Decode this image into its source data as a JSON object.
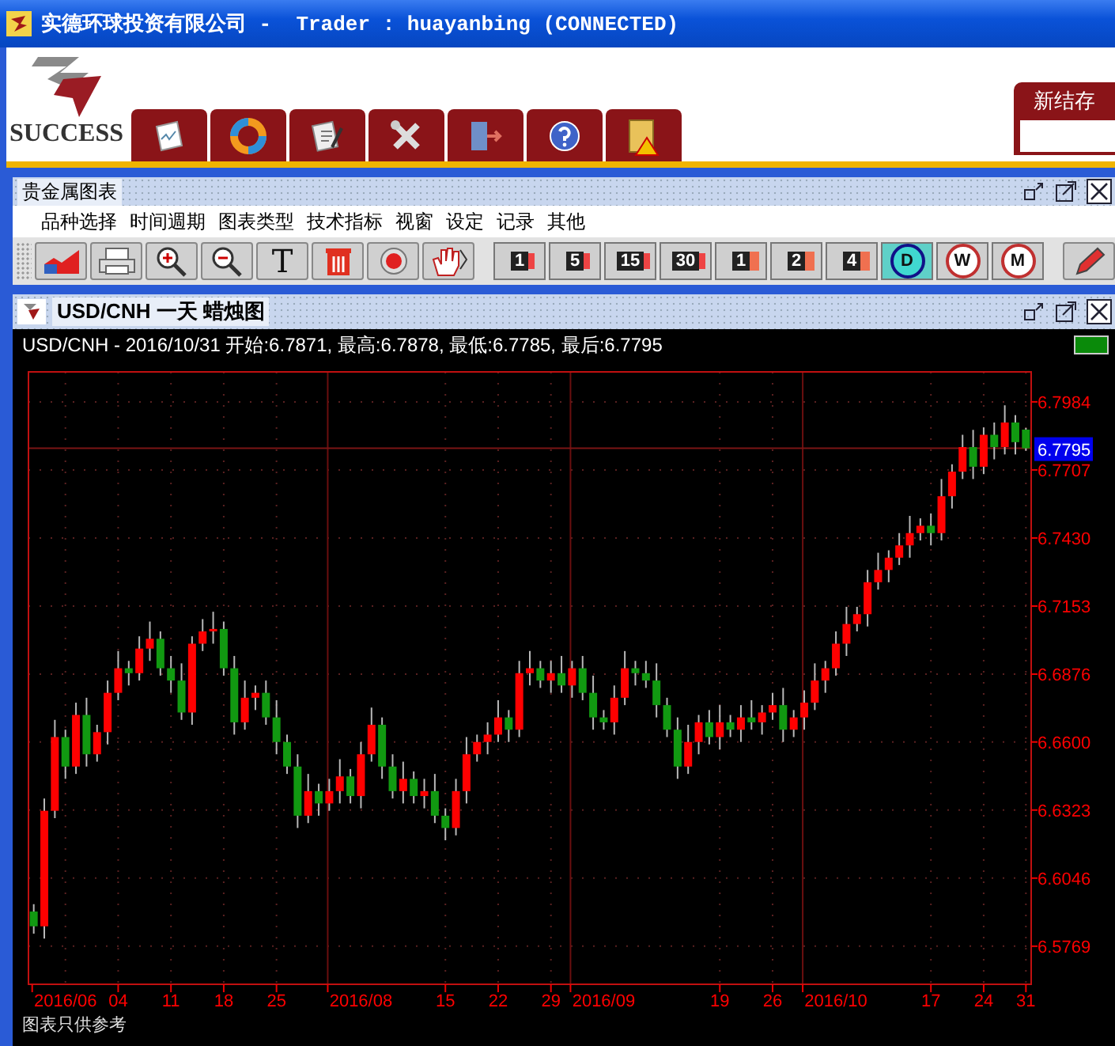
{
  "window": {
    "title": "实德环球投资有限公司 -  Trader : huayanbing (CONNECTED)"
  },
  "brand": {
    "name": "SUCCESS"
  },
  "balance_panel": {
    "label": "新结存"
  },
  "panel": {
    "title": "贵金属图表",
    "menu": [
      "品种选择",
      "时间週期",
      "图表类型",
      "技术指标",
      "视窗",
      "设定",
      "记录",
      "其他"
    ]
  },
  "toolbar": {
    "text_tool": "T",
    "periods": [
      {
        "label": "1",
        "kind": "minute",
        "selected": false
      },
      {
        "label": "5",
        "kind": "minute",
        "selected": false
      },
      {
        "label": "15",
        "kind": "minute",
        "selected": false
      },
      {
        "label": "30",
        "kind": "minute",
        "selected": false
      },
      {
        "label": "1",
        "kind": "hour",
        "selected": false
      },
      {
        "label": "2",
        "kind": "hour",
        "selected": false
      },
      {
        "label": "4",
        "kind": "hour",
        "selected": false
      },
      {
        "label": "D",
        "kind": "day",
        "selected": true
      },
      {
        "label": "W",
        "kind": "day",
        "selected": false
      },
      {
        "label": "M",
        "kind": "day",
        "selected": false
      }
    ]
  },
  "chart_window": {
    "title": "USD/CNH 一天 蜡烛图",
    "info": "USD/CNH - 2016/10/31 开始:6.7871, 最高:6.7878, 最低:6.7785, 最后:6.7795",
    "chart_data": {
      "type": "candlestick",
      "categories": [
        null,
        null,
        null,
        "2016/06",
        null,
        null,
        null,
        null,
        "04",
        null,
        null,
        null,
        null,
        "11",
        null,
        null,
        null,
        null,
        "18",
        null,
        null,
        null,
        null,
        "25",
        null,
        null,
        null,
        null,
        null,
        null,
        null,
        "2016/08",
        null,
        null,
        null,
        null,
        null,
        null,
        null,
        "15",
        null,
        null,
        null,
        null,
        "22",
        null,
        null,
        null,
        null,
        "29",
        null,
        null,
        null,
        null,
        "2016/09",
        null,
        null,
        null,
        null,
        null,
        null,
        null,
        null,
        null,
        null,
        "19",
        null,
        null,
        null,
        null,
        "26",
        null,
        null,
        null,
        null,
        null,
        "2016/10",
        null,
        null,
        null,
        null,
        null,
        null,
        null,
        null,
        "17",
        null,
        null,
        null,
        null,
        "24",
        null,
        null,
        null,
        "31"
      ],
      "ohlc": [
        [
          6.591,
          6.594,
          6.582,
          6.585
        ],
        [
          6.585,
          6.637,
          6.58,
          6.632
        ],
        [
          6.632,
          6.669,
          6.629,
          6.662
        ],
        [
          6.662,
          6.665,
          6.645,
          6.65
        ],
        [
          6.65,
          6.676,
          6.647,
          6.671
        ],
        [
          6.671,
          6.678,
          6.65,
          6.655
        ],
        [
          6.655,
          6.667,
          6.652,
          6.664
        ],
        [
          6.664,
          6.685,
          6.659,
          6.68
        ],
        [
          6.68,
          6.697,
          6.677,
          6.69
        ],
        [
          6.69,
          6.693,
          6.683,
          6.688
        ],
        [
          6.688,
          6.703,
          6.685,
          6.698
        ],
        [
          6.698,
          6.709,
          6.693,
          6.702
        ],
        [
          6.702,
          6.705,
          6.687,
          6.69
        ],
        [
          6.69,
          6.695,
          6.68,
          6.685
        ],
        [
          6.685,
          6.692,
          6.669,
          6.672
        ],
        [
          6.672,
          6.703,
          6.667,
          6.7
        ],
        [
          6.7,
          6.71,
          6.697,
          6.705
        ],
        [
          6.705,
          6.713,
          6.7,
          6.706
        ],
        [
          6.706,
          6.709,
          6.687,
          6.69
        ],
        [
          6.69,
          6.695,
          6.663,
          6.668
        ],
        [
          6.668,
          6.685,
          6.665,
          6.678
        ],
        [
          6.678,
          6.683,
          6.673,
          6.68
        ],
        [
          6.68,
          6.685,
          6.667,
          6.67
        ],
        [
          6.67,
          6.677,
          6.655,
          6.66
        ],
        [
          6.66,
          6.663,
          6.647,
          6.65
        ],
        [
          6.65,
          6.655,
          6.625,
          6.63
        ],
        [
          6.63,
          6.647,
          6.627,
          6.64
        ],
        [
          6.64,
          6.643,
          6.63,
          6.635
        ],
        [
          6.635,
          6.645,
          6.632,
          6.64
        ],
        [
          6.64,
          6.653,
          6.635,
          6.646
        ],
        [
          6.646,
          6.649,
          6.635,
          6.638
        ],
        [
          6.638,
          6.66,
          6.633,
          6.655
        ],
        [
          6.655,
          6.674,
          6.652,
          6.667
        ],
        [
          6.667,
          6.67,
          6.645,
          6.65
        ],
        [
          6.65,
          6.655,
          6.637,
          6.64
        ],
        [
          6.64,
          6.652,
          6.635,
          6.645
        ],
        [
          6.645,
          6.648,
          6.635,
          6.638
        ],
        [
          6.638,
          6.645,
          6.633,
          6.64
        ],
        [
          6.64,
          6.647,
          6.627,
          6.63
        ],
        [
          6.63,
          6.633,
          6.62,
          6.625
        ],
        [
          6.625,
          6.645,
          6.622,
          6.64
        ],
        [
          6.64,
          6.662,
          6.635,
          6.655
        ],
        [
          6.655,
          6.663,
          6.652,
          6.66
        ],
        [
          6.66,
          6.668,
          6.655,
          6.663
        ],
        [
          6.663,
          6.677,
          6.66,
          6.67
        ],
        [
          6.67,
          6.673,
          6.66,
          6.665
        ],
        [
          6.665,
          6.693,
          6.662,
          6.688
        ],
        [
          6.688,
          6.697,
          6.683,
          6.69
        ],
        [
          6.69,
          6.693,
          6.682,
          6.685
        ],
        [
          6.685,
          6.693,
          6.68,
          6.688
        ],
        [
          6.688,
          6.695,
          6.68,
          6.683
        ],
        [
          6.683,
          6.693,
          6.678,
          6.69
        ],
        [
          6.69,
          6.695,
          6.677,
          6.68
        ],
        [
          6.68,
          6.687,
          6.665,
          6.67
        ],
        [
          6.67,
          6.673,
          6.665,
          6.668
        ],
        [
          6.668,
          6.683,
          6.663,
          6.678
        ],
        [
          6.678,
          6.697,
          6.675,
          6.69
        ],
        [
          6.69,
          6.693,
          6.683,
          6.688
        ],
        [
          6.688,
          6.693,
          6.682,
          6.685
        ],
        [
          6.685,
          6.692,
          6.67,
          6.675
        ],
        [
          6.675,
          6.678,
          6.662,
          6.665
        ],
        [
          6.665,
          6.67,
          6.645,
          6.65
        ],
        [
          6.65,
          6.667,
          6.647,
          6.66
        ],
        [
          6.66,
          6.671,
          6.655,
          6.668
        ],
        [
          6.668,
          6.673,
          6.659,
          6.662
        ],
        [
          6.662,
          6.675,
          6.657,
          6.668
        ],
        [
          6.668,
          6.671,
          6.662,
          6.665
        ],
        [
          6.665,
          6.675,
          6.66,
          6.67
        ],
        [
          6.67,
          6.677,
          6.665,
          6.668
        ],
        [
          6.668,
          6.675,
          6.663,
          6.672
        ],
        [
          6.672,
          6.68,
          6.669,
          6.675
        ],
        [
          6.675,
          6.682,
          6.66,
          6.665
        ],
        [
          6.665,
          6.673,
          6.662,
          6.67
        ],
        [
          6.67,
          6.681,
          6.665,
          6.676
        ],
        [
          6.676,
          6.692,
          6.673,
          6.685
        ],
        [
          6.685,
          6.693,
          6.68,
          6.69
        ],
        [
          6.69,
          6.705,
          6.687,
          6.7
        ],
        [
          6.7,
          6.715,
          6.695,
          6.708
        ],
        [
          6.708,
          6.715,
          6.705,
          6.712
        ],
        [
          6.712,
          6.73,
          6.707,
          6.725
        ],
        [
          6.725,
          6.737,
          6.722,
          6.73
        ],
        [
          6.73,
          6.738,
          6.725,
          6.735
        ],
        [
          6.735,
          6.745,
          6.732,
          6.74
        ],
        [
          6.74,
          6.752,
          6.735,
          6.745
        ],
        [
          6.745,
          6.751,
          6.742,
          6.748
        ],
        [
          6.748,
          6.753,
          6.74,
          6.745
        ],
        [
          6.745,
          6.767,
          6.742,
          6.76
        ],
        [
          6.76,
          6.773,
          6.755,
          6.77
        ],
        [
          6.77,
          6.785,
          6.767,
          6.78
        ],
        [
          6.78,
          6.787,
          6.767,
          6.772
        ],
        [
          6.772,
          6.788,
          6.769,
          6.785
        ],
        [
          6.785,
          6.79,
          6.775,
          6.78
        ],
        [
          6.78,
          6.797,
          6.777,
          6.79
        ],
        [
          6.79,
          6.793,
          6.777,
          6.782
        ],
        [
          6.7871,
          6.7878,
          6.7785,
          6.7795
        ]
      ],
      "ylim": [
        6.5614,
        6.8106
      ],
      "grid": true,
      "yticks": [
        {
          "value": 6.5769,
          "label": "6.5769"
        },
        {
          "value": 6.6046,
          "label": "6.6046"
        },
        {
          "value": 6.6323,
          "label": "6.6323"
        },
        {
          "value": 6.66,
          "label": "6.6600"
        },
        {
          "value": 6.6876,
          "label": "6.6876"
        },
        {
          "value": 6.7153,
          "label": "6.7153"
        },
        {
          "value": 6.743,
          "label": "6.7430"
        },
        {
          "value": 6.7707,
          "label": "6.7707"
        },
        {
          "value": 6.7984,
          "label": "6.7984"
        }
      ],
      "ref_lines": [
        {
          "axis": "y",
          "value": 6.7795,
          "label": "6.7795"
        }
      ]
    },
    "footer": "图表只供参考"
  }
}
